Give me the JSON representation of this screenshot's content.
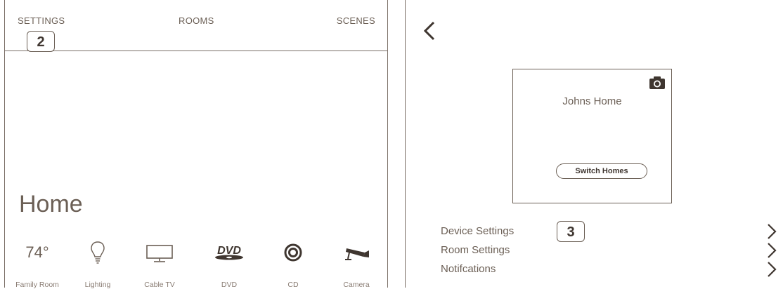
{
  "left": {
    "tabs": [
      {
        "label": "SETTINGS"
      },
      {
        "label": "ROOMS"
      },
      {
        "label": "SCENES"
      }
    ],
    "callout_settings": "2",
    "page_title": "Home",
    "dock": [
      {
        "label": "Family Room",
        "value": "74°",
        "icon": "thermostat-value"
      },
      {
        "label": "Lighting",
        "icon": "lightbulb-icon"
      },
      {
        "label": "Cable TV",
        "icon": "tv-icon"
      },
      {
        "label": "DVD",
        "icon": "dvd-icon"
      },
      {
        "label": "CD",
        "icon": "cd-icon"
      },
      {
        "label": "Camera",
        "icon": "security-camera-icon"
      }
    ]
  },
  "right": {
    "back_icon": "chevron-left-icon",
    "home_card": {
      "home_name": "Johns Home",
      "camera_icon": "camera-icon",
      "switch_label": "Switch Homes"
    },
    "rows": [
      {
        "label": "Device Settings",
        "callout": "3"
      },
      {
        "label": "Room Settings"
      },
      {
        "label": "Notifcations"
      }
    ]
  },
  "colors": {
    "text": "#6b5f55",
    "border": "#7a6e66",
    "background": "#ffffff"
  }
}
